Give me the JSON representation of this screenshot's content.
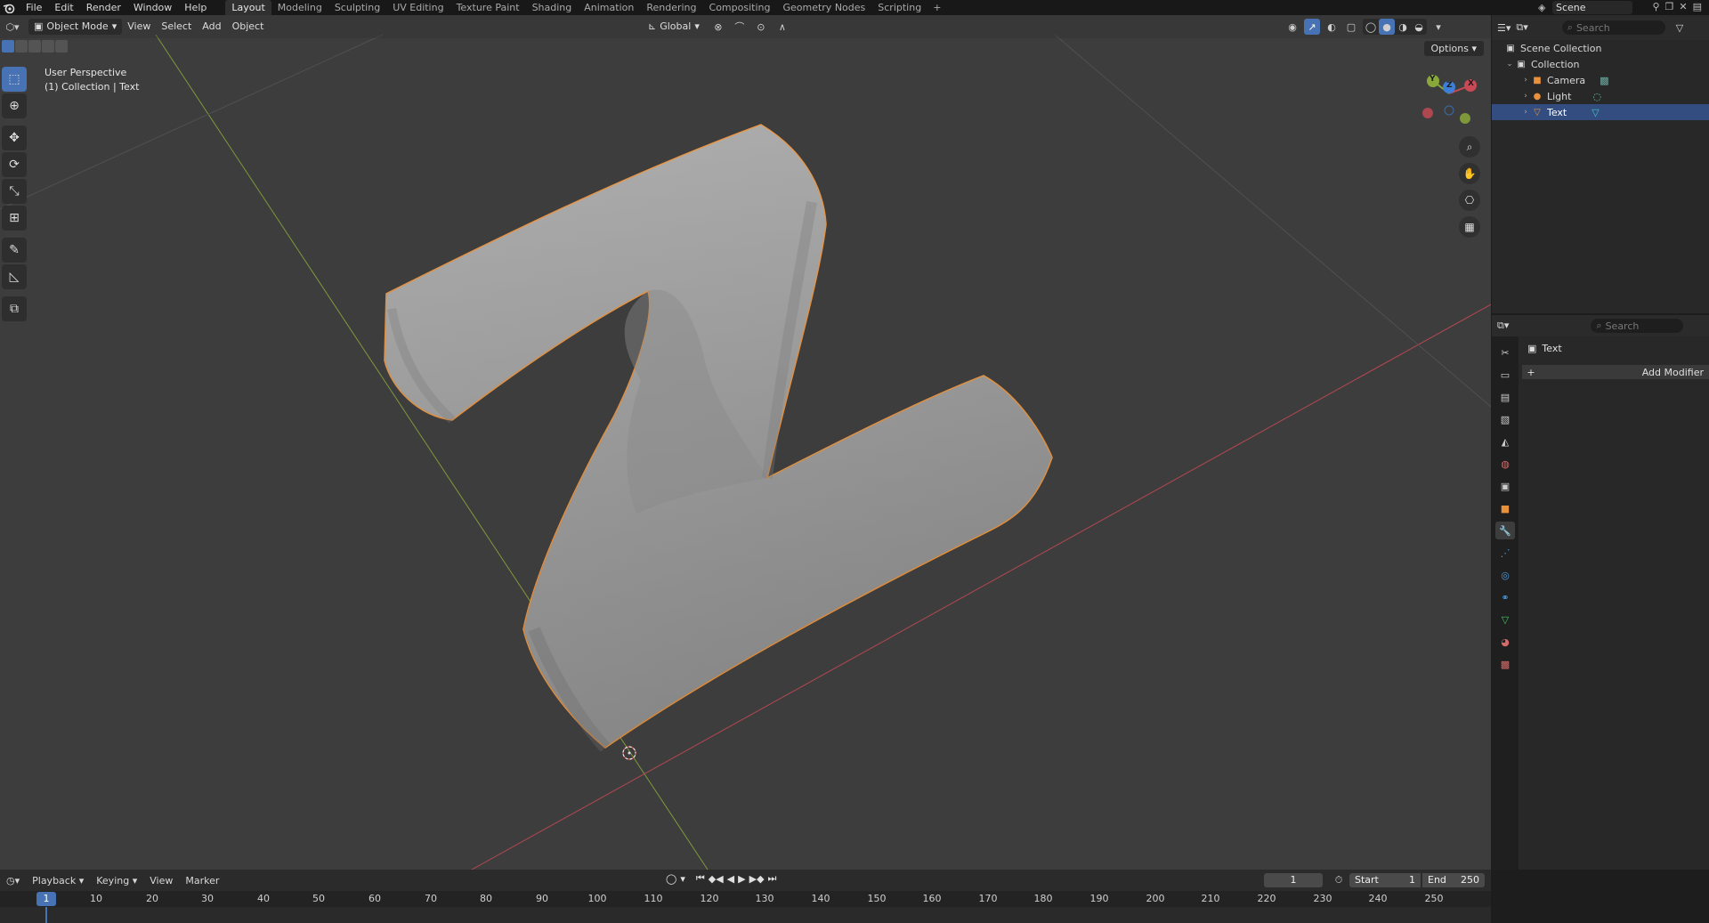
{
  "menu": {
    "items": [
      "File",
      "Edit",
      "Render",
      "Window",
      "Help"
    ]
  },
  "workspaces": [
    "Layout",
    "Modeling",
    "Sculpting",
    "UV Editing",
    "Texture Paint",
    "Shading",
    "Animation",
    "Rendering",
    "Compositing",
    "Geometry Nodes",
    "Scripting"
  ],
  "workspace_add": "+",
  "scene": {
    "name": "Scene"
  },
  "viewport": {
    "mode": "Object Mode",
    "menus": [
      "View",
      "Select",
      "Add",
      "Object"
    ],
    "orientation": "Global",
    "options_label": "Options",
    "info_line1": "User Perspective",
    "info_line2": "(1) Collection | Text",
    "gizmo": {
      "x": "X",
      "y": "Y",
      "z": "Z"
    }
  },
  "outliner": {
    "search_placeholder": "Search",
    "root": "Scene Collection",
    "collection": "Collection",
    "items": [
      {
        "label": "Camera",
        "icon": "camera-icon",
        "color": "#e8903a"
      },
      {
        "label": "Light",
        "icon": "light-icon",
        "color": "#e8903a"
      },
      {
        "label": "Text",
        "icon": "text-object-icon",
        "color": "#e8903a"
      }
    ]
  },
  "properties": {
    "search_placeholder": "Search",
    "object_name": "Text",
    "add_modifier": "Add Modifier"
  },
  "timeline": {
    "menus": [
      "Playback",
      "Keying",
      "View",
      "Marker"
    ],
    "current_frame": "1",
    "start_label": "Start",
    "start_value": "1",
    "end_label": "End",
    "end_value": "250",
    "ruler": [
      "10",
      "20",
      "30",
      "40",
      "50",
      "60",
      "70",
      "80",
      "90",
      "100",
      "110",
      "120",
      "130",
      "140",
      "150",
      "160",
      "170",
      "180",
      "190",
      "200",
      "210",
      "220",
      "230",
      "240",
      "250"
    ]
  },
  "colors": {
    "accent": "#4772b3",
    "selection_outline": "#e8903a",
    "x_axis": "#c94a55",
    "y_axis": "#8aa83a",
    "z_axis": "#3d7fd6"
  }
}
